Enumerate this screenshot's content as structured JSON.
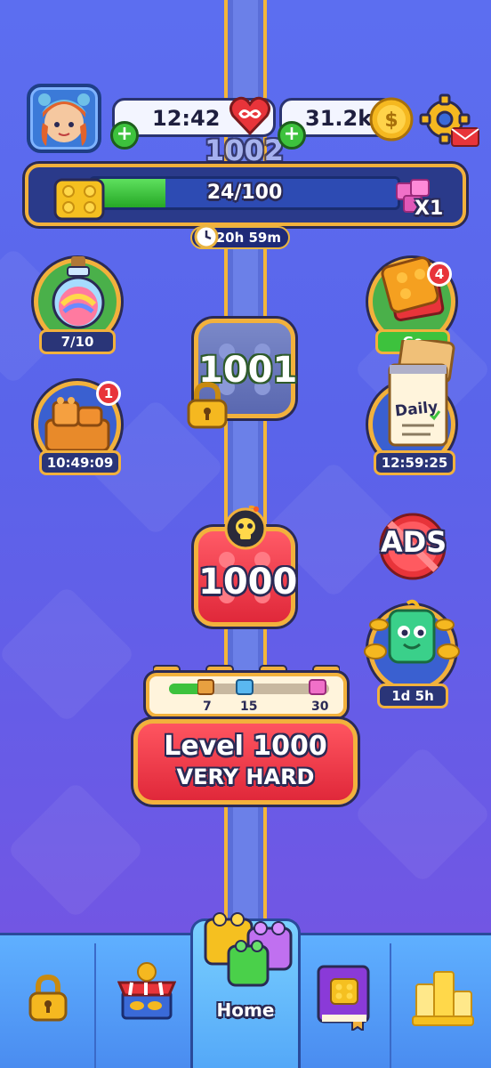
{
  "top_bar": {
    "lives_timer": "12:42",
    "coins": "31.2k",
    "level_marker": "1002"
  },
  "progress": {
    "label": "24/100",
    "value": 24,
    "max": 100,
    "multiplier": "X1",
    "timer": "20h 59m"
  },
  "left_features": [
    {
      "label": "7/10"
    },
    {
      "label": "10:49:09",
      "badge": "1"
    }
  ],
  "right_features": [
    {
      "label": "Go",
      "badge": "4"
    },
    {
      "label": "12:59:25",
      "note": "Daily"
    },
    {
      "label": "ADS"
    },
    {
      "label": "1d 5h"
    }
  ],
  "levels": {
    "locked": "1001",
    "current": "1000"
  },
  "level_progress": {
    "milestones": [
      "7",
      "15",
      "30"
    ]
  },
  "play_button": {
    "line1": "Level 1000",
    "line2": "VERY HARD"
  },
  "nav": {
    "home_label": "Home"
  },
  "colors": {
    "accent_gold": "#f2b13c",
    "outline": "#2a2a55",
    "red": "#e0283a",
    "green": "#3dc23d"
  }
}
